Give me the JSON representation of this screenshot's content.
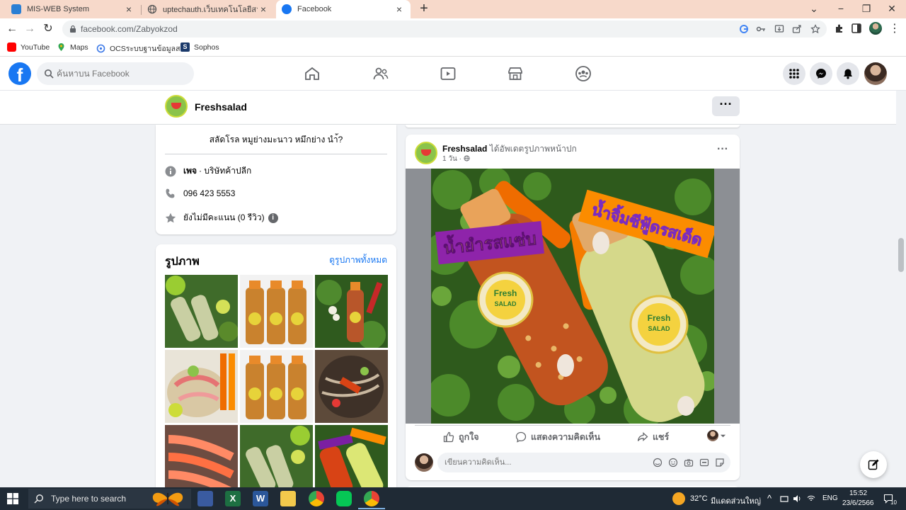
{
  "browser": {
    "tabs": [
      {
        "label": "MIS-WEB System",
        "favicon": "mis-icon"
      },
      {
        "label": "uptechauth.เว็บเทคโนโลยีสารสนเทศ",
        "favicon": "globe-icon"
      },
      {
        "label": "Facebook",
        "favicon": "facebook-icon"
      }
    ],
    "url": "facebook.com/Zabyokzod",
    "bookmarks": [
      {
        "label": "YouTube",
        "icon": "youtube-icon"
      },
      {
        "label": "Maps",
        "icon": "maps-icon"
      },
      {
        "label": "OCSระบบฐานข้อมูลส ...",
        "icon": "ocs-icon"
      },
      {
        "label": "Sophos",
        "icon": "sophos-icon"
      }
    ]
  },
  "facebook": {
    "logo": "f",
    "search_placeholder": "ค้นหาบน Facebook"
  },
  "page": {
    "name": "Freshsalad",
    "more_label": "···",
    "intro": {
      "bio": "สลัดโรล หมูย่างมะนาว หมึกย่าง นำ้?",
      "category_label": "เพจ",
      "category_value": "· บริษัทค้าปลีก",
      "phone": "096 423 5553",
      "reviews": "ยังไม่มีคะแนน (0 รีวิว)",
      "reviews_badge": "i"
    },
    "photos": {
      "title": "รูปภาพ",
      "see_all": "ดูรูปภาพทั้งหมด"
    }
  },
  "post": {
    "author": "Freshsalad",
    "action_text": "ได้อัพเดตรูปภาพหน้าปก",
    "time": "1 วัน · ",
    "more_label": "···",
    "image_text_left": "น้ำยำรสแซ่บ",
    "image_text_right": "น้ำจิ้มซีฟู้ดรสเด็ด",
    "label_brand": "Fresh",
    "label_sub": "SALAD",
    "like_label": "ถูกใจ",
    "comment_label": "แสดงความคิดเห็น",
    "share_label": "แชร์",
    "comment_placeholder": "เขียนความคิดเห็น..."
  },
  "taskbar": {
    "search_text": "Type here to search",
    "temperature": "32°C",
    "weather": "มีแดดส่วนใหญ่",
    "lang": "ENG",
    "time": "15:52",
    "date": "23/6/2566",
    "notification_count": "10"
  },
  "colors": {
    "facebook_blue": "#1877f2",
    "tabstrip": "#f7d9ca",
    "taskbar": "#1f2a35"
  }
}
